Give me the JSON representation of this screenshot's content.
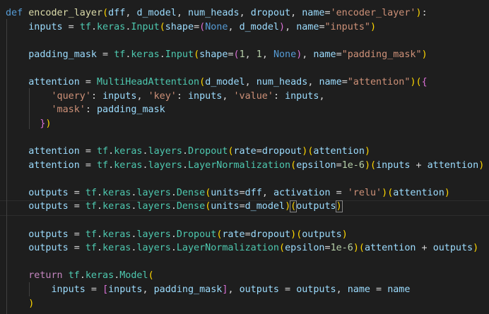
{
  "editor": {
    "theme": "dark",
    "colors": {
      "background": "#1e1e1e",
      "keyword_def": "#569cd6",
      "keyword_control": "#c586c0",
      "function": "#dcdcaa",
      "class": "#4ec9b0",
      "variable": "#9cdcfe",
      "string": "#ce9178",
      "number": "#b5cea8",
      "bracket_1": "#ffd700",
      "bracket_2": "#da70d6",
      "bracket_3": "#179fff"
    },
    "lines": [
      [
        [
          "kw-def",
          "def"
        ],
        [
          "op",
          " "
        ],
        [
          "fn",
          "encoder_layer"
        ],
        [
          "b1",
          "("
        ],
        [
          "var",
          "dff"
        ],
        [
          "op",
          ", "
        ],
        [
          "var",
          "d_model"
        ],
        [
          "op",
          ", "
        ],
        [
          "var",
          "num_heads"
        ],
        [
          "op",
          ", "
        ],
        [
          "var",
          "dropout"
        ],
        [
          "op",
          ", "
        ],
        [
          "var",
          "name"
        ],
        [
          "op",
          "="
        ],
        [
          "str",
          "'encoder_layer'"
        ],
        [
          "b1",
          ")"
        ],
        [
          "op",
          ":"
        ]
      ],
      [
        [
          "op",
          "    "
        ],
        [
          "var",
          "inputs"
        ],
        [
          "op",
          " = "
        ],
        [
          "cls",
          "tf"
        ],
        [
          "op",
          "."
        ],
        [
          "cls",
          "keras"
        ],
        [
          "op",
          "."
        ],
        [
          "cls",
          "Input"
        ],
        [
          "b1",
          "("
        ],
        [
          "var",
          "shape"
        ],
        [
          "op",
          "="
        ],
        [
          "b2",
          "("
        ],
        [
          "kwc",
          "None"
        ],
        [
          "op",
          ", "
        ],
        [
          "var",
          "d_model"
        ],
        [
          "b2",
          ")"
        ],
        [
          "op",
          ", "
        ],
        [
          "var",
          "name"
        ],
        [
          "op",
          "="
        ],
        [
          "str",
          "\"inputs\""
        ],
        [
          "b1",
          ")"
        ]
      ],
      [],
      [
        [
          "op",
          "    "
        ],
        [
          "var",
          "padding_mask"
        ],
        [
          "op",
          " = "
        ],
        [
          "cls",
          "tf"
        ],
        [
          "op",
          "."
        ],
        [
          "cls",
          "keras"
        ],
        [
          "op",
          "."
        ],
        [
          "cls",
          "Input"
        ],
        [
          "b1",
          "("
        ],
        [
          "var",
          "shape"
        ],
        [
          "op",
          "="
        ],
        [
          "b2",
          "("
        ],
        [
          "num",
          "1"
        ],
        [
          "op",
          ", "
        ],
        [
          "num",
          "1"
        ],
        [
          "op",
          ", "
        ],
        [
          "kwc",
          "None"
        ],
        [
          "b2",
          ")"
        ],
        [
          "op",
          ", "
        ],
        [
          "var",
          "name"
        ],
        [
          "op",
          "="
        ],
        [
          "str",
          "\"padding_mask\""
        ],
        [
          "b1",
          ")"
        ]
      ],
      [],
      [
        [
          "op",
          "    "
        ],
        [
          "var",
          "attention"
        ],
        [
          "op",
          " = "
        ],
        [
          "cls",
          "MultiHeadAttention"
        ],
        [
          "b1",
          "("
        ],
        [
          "var",
          "d_model"
        ],
        [
          "op",
          ", "
        ],
        [
          "var",
          "num_heads"
        ],
        [
          "op",
          ", "
        ],
        [
          "var",
          "name"
        ],
        [
          "op",
          "="
        ],
        [
          "str",
          "\"attention\""
        ],
        [
          "b1",
          ")"
        ],
        [
          "b1",
          "("
        ],
        [
          "b2",
          "{"
        ]
      ],
      [
        [
          "op",
          "        "
        ],
        [
          "str",
          "'query'"
        ],
        [
          "op",
          ": "
        ],
        [
          "var",
          "inputs"
        ],
        [
          "op",
          ", "
        ],
        [
          "str",
          "'key'"
        ],
        [
          "op",
          ": "
        ],
        [
          "var",
          "inputs"
        ],
        [
          "op",
          ", "
        ],
        [
          "str",
          "'value'"
        ],
        [
          "op",
          ": "
        ],
        [
          "var",
          "inputs"
        ],
        [
          "op",
          ","
        ]
      ],
      [
        [
          "op",
          "        "
        ],
        [
          "str",
          "'mask'"
        ],
        [
          "op",
          ": "
        ],
        [
          "var",
          "padding_mask"
        ]
      ],
      [
        [
          "op",
          "      "
        ],
        [
          "b2",
          "}"
        ],
        [
          "b1",
          ")"
        ]
      ],
      [],
      [
        [
          "op",
          "    "
        ],
        [
          "var",
          "attention"
        ],
        [
          "op",
          " = "
        ],
        [
          "cls",
          "tf"
        ],
        [
          "op",
          "."
        ],
        [
          "cls",
          "keras"
        ],
        [
          "op",
          "."
        ],
        [
          "cls",
          "layers"
        ],
        [
          "op",
          "."
        ],
        [
          "cls",
          "Dropout"
        ],
        [
          "b1",
          "("
        ],
        [
          "var",
          "rate"
        ],
        [
          "op",
          "="
        ],
        [
          "var",
          "dropout"
        ],
        [
          "b1",
          ")"
        ],
        [
          "b1",
          "("
        ],
        [
          "var",
          "attention"
        ],
        [
          "b1",
          ")"
        ]
      ],
      [
        [
          "op",
          "    "
        ],
        [
          "var",
          "attention"
        ],
        [
          "op",
          " = "
        ],
        [
          "cls",
          "tf"
        ],
        [
          "op",
          "."
        ],
        [
          "cls",
          "keras"
        ],
        [
          "op",
          "."
        ],
        [
          "cls",
          "layers"
        ],
        [
          "op",
          "."
        ],
        [
          "cls",
          "LayerNormalization"
        ],
        [
          "b1",
          "("
        ],
        [
          "var",
          "epsilon"
        ],
        [
          "op",
          "="
        ],
        [
          "num",
          "1e-6"
        ],
        [
          "b1",
          ")"
        ],
        [
          "b1",
          "("
        ],
        [
          "var",
          "inputs"
        ],
        [
          "op",
          " + "
        ],
        [
          "var",
          "attention"
        ],
        [
          "b1",
          ")"
        ]
      ],
      [],
      [
        [
          "op",
          "    "
        ],
        [
          "var",
          "outputs"
        ],
        [
          "op",
          " = "
        ],
        [
          "cls",
          "tf"
        ],
        [
          "op",
          "."
        ],
        [
          "cls",
          "keras"
        ],
        [
          "op",
          "."
        ],
        [
          "cls",
          "layers"
        ],
        [
          "op",
          "."
        ],
        [
          "cls",
          "Dense"
        ],
        [
          "b1",
          "("
        ],
        [
          "var",
          "units"
        ],
        [
          "op",
          "="
        ],
        [
          "var",
          "dff"
        ],
        [
          "op",
          ", "
        ],
        [
          "var",
          "activation"
        ],
        [
          "op",
          " = "
        ],
        [
          "str",
          "'relu'"
        ],
        [
          "b1",
          ")"
        ],
        [
          "b1",
          "("
        ],
        [
          "var",
          "attention"
        ],
        [
          "b1",
          ")"
        ]
      ],
      [
        [
          "op",
          "    "
        ],
        [
          "var",
          "outputs"
        ],
        [
          "op",
          " = "
        ],
        [
          "cls",
          "tf"
        ],
        [
          "op",
          "."
        ],
        [
          "cls",
          "keras"
        ],
        [
          "op",
          "."
        ],
        [
          "cls",
          "layers"
        ],
        [
          "op",
          "."
        ],
        [
          "cls",
          "Dense"
        ],
        [
          "b1",
          "("
        ],
        [
          "var",
          "units"
        ],
        [
          "op",
          "="
        ],
        [
          "var",
          "d_model"
        ],
        [
          "b1",
          ")"
        ],
        [
          "b1 match",
          "("
        ],
        [
          "var",
          "outputs"
        ],
        [
          "b1 match",
          ")"
        ]
      ],
      [],
      [
        [
          "op",
          "    "
        ],
        [
          "var",
          "outputs"
        ],
        [
          "op",
          " = "
        ],
        [
          "cls",
          "tf"
        ],
        [
          "op",
          "."
        ],
        [
          "cls",
          "keras"
        ],
        [
          "op",
          "."
        ],
        [
          "cls",
          "layers"
        ],
        [
          "op",
          "."
        ],
        [
          "cls",
          "Dropout"
        ],
        [
          "b1",
          "("
        ],
        [
          "var",
          "rate"
        ],
        [
          "op",
          "="
        ],
        [
          "var",
          "dropout"
        ],
        [
          "b1",
          ")"
        ],
        [
          "b1",
          "("
        ],
        [
          "var",
          "outputs"
        ],
        [
          "b1",
          ")"
        ]
      ],
      [
        [
          "op",
          "    "
        ],
        [
          "var",
          "outputs"
        ],
        [
          "op",
          " = "
        ],
        [
          "cls",
          "tf"
        ],
        [
          "op",
          "."
        ],
        [
          "cls",
          "keras"
        ],
        [
          "op",
          "."
        ],
        [
          "cls",
          "layers"
        ],
        [
          "op",
          "."
        ],
        [
          "cls",
          "LayerNormalization"
        ],
        [
          "b1",
          "("
        ],
        [
          "var",
          "epsilon"
        ],
        [
          "op",
          "="
        ],
        [
          "num",
          "1e-6"
        ],
        [
          "b1",
          ")"
        ],
        [
          "b1",
          "("
        ],
        [
          "var",
          "attention"
        ],
        [
          "op",
          " + "
        ],
        [
          "var",
          "outputs"
        ],
        [
          "b1",
          ")"
        ]
      ],
      [],
      [
        [
          "op",
          "    "
        ],
        [
          "kw",
          "return"
        ],
        [
          "op",
          " "
        ],
        [
          "cls",
          "tf"
        ],
        [
          "op",
          "."
        ],
        [
          "cls",
          "keras"
        ],
        [
          "op",
          "."
        ],
        [
          "cls",
          "Model"
        ],
        [
          "b1",
          "("
        ]
      ],
      [
        [
          "op",
          "        "
        ],
        [
          "var",
          "inputs"
        ],
        [
          "op",
          " = "
        ],
        [
          "b2",
          "["
        ],
        [
          "var",
          "inputs"
        ],
        [
          "op",
          ", "
        ],
        [
          "var",
          "padding_mask"
        ],
        [
          "b2",
          "]"
        ],
        [
          "op",
          ", "
        ],
        [
          "var",
          "outputs"
        ],
        [
          "op",
          " = "
        ],
        [
          "var",
          "outputs"
        ],
        [
          "op",
          ", "
        ],
        [
          "var",
          "name"
        ],
        [
          "op",
          " = "
        ],
        [
          "var",
          "name"
        ]
      ],
      [
        [
          "op",
          "    "
        ],
        [
          "b1",
          ")"
        ]
      ]
    ]
  }
}
